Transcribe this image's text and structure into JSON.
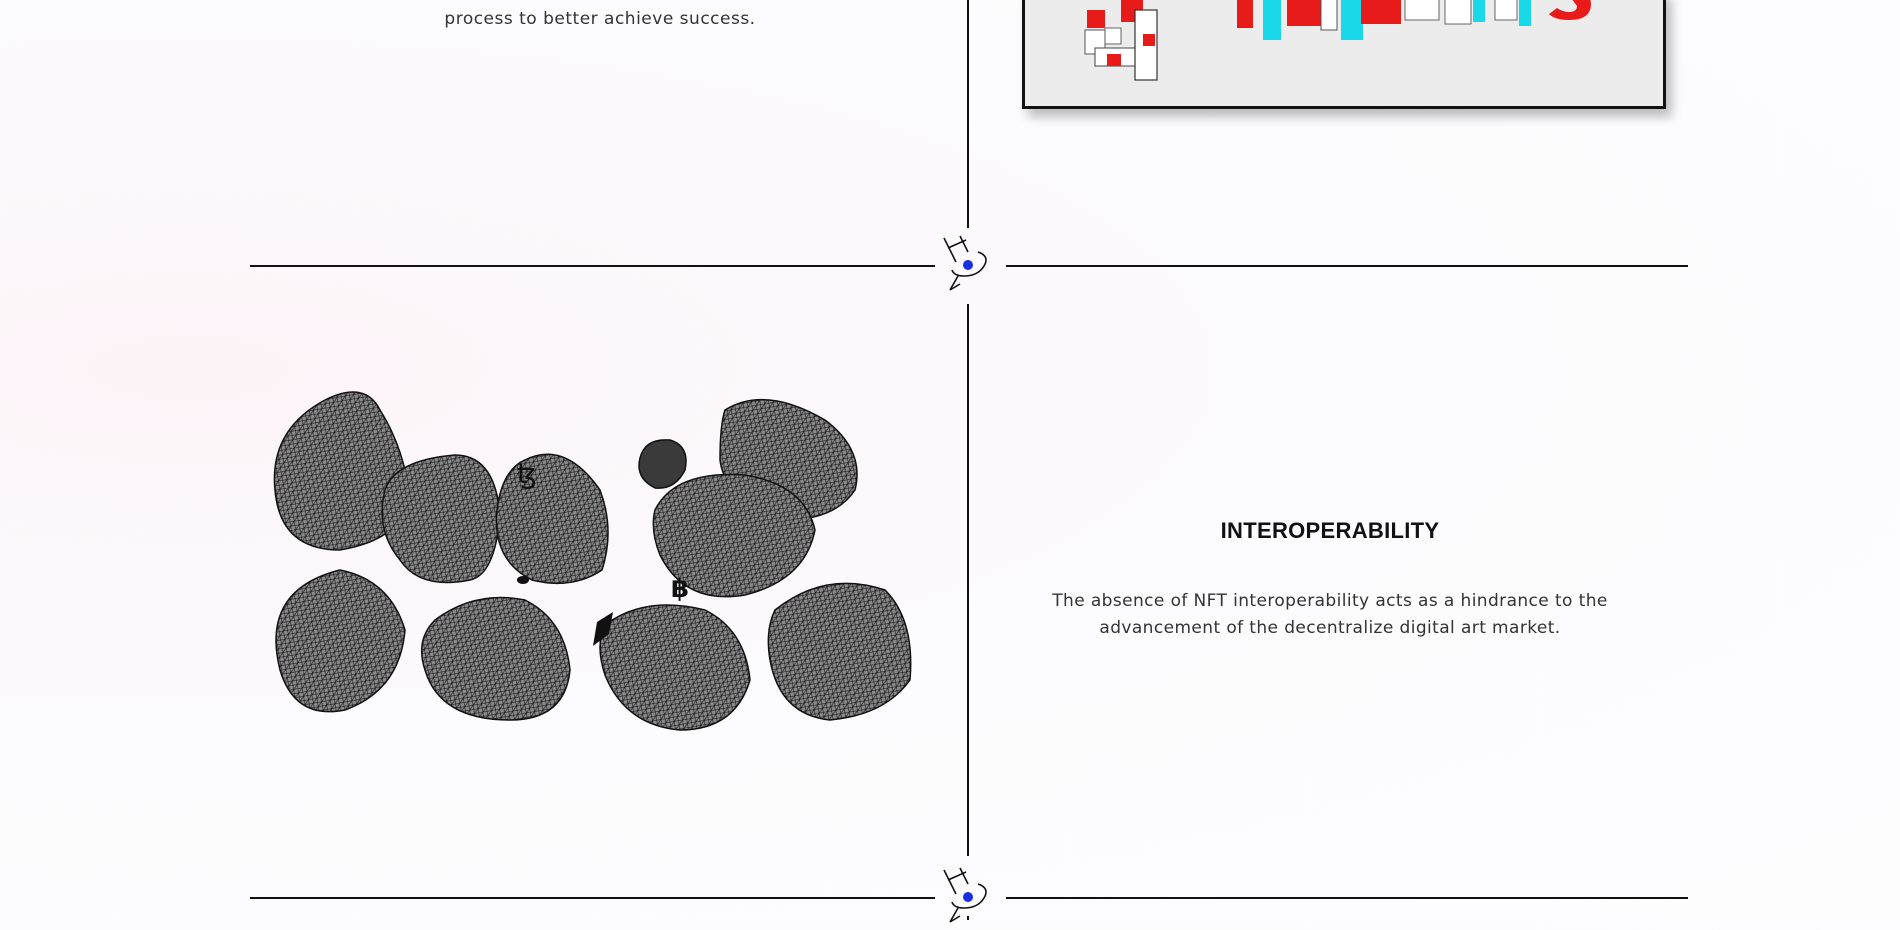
{
  "intro": {
    "text_tail": "process to better achieve success."
  },
  "poster": {
    "icon": "4-posters-artwork"
  },
  "section": {
    "title": "INTEROPERABILITY",
    "description_line1": "The absence of NFT interoperability acts as a hindrance to the",
    "description_line2": "advancement of the decentralize digital art market."
  },
  "illustration": {
    "icon": "crypto-rocks-wireframe"
  },
  "divider": {
    "icon": "signature-logo-icon",
    "accent": "#1a2fe0"
  }
}
